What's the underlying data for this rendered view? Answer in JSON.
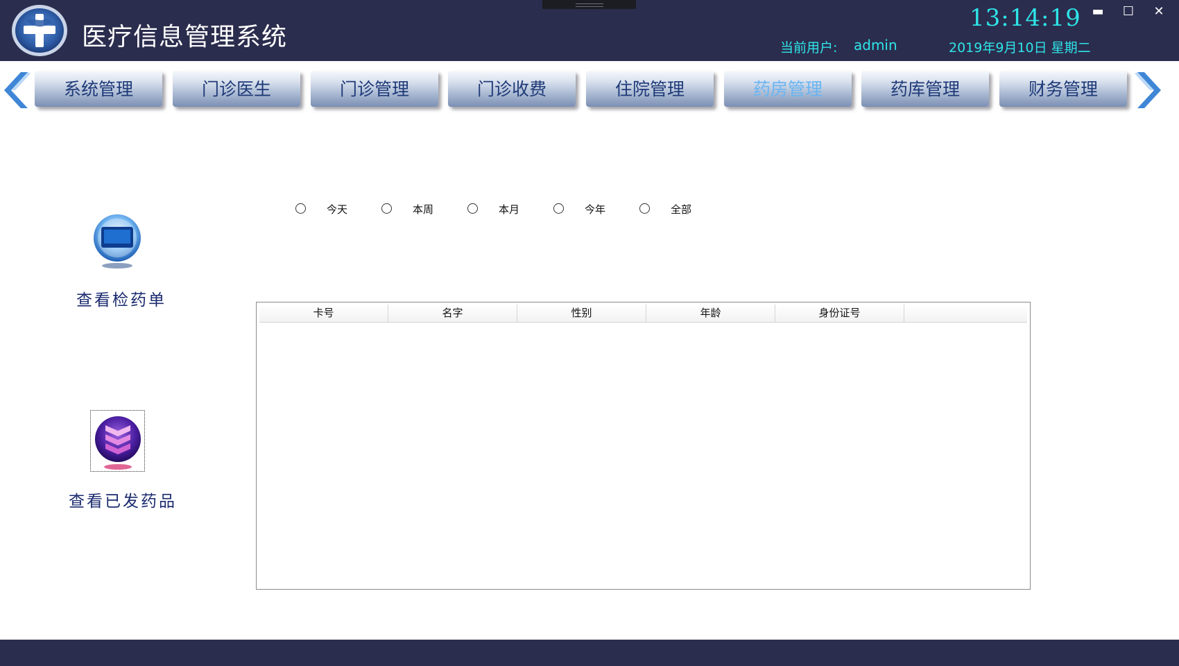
{
  "header": {
    "title": "医疗信息管理系统",
    "clock": "13:14:19",
    "user_label": "当前用户:",
    "user_name": "admin",
    "date": "2019年9月10日 星期二",
    "window_controls": {
      "minimize": "▬",
      "maximize": "☐",
      "close": "✕"
    }
  },
  "nav": {
    "items": [
      {
        "label": "系统管理"
      },
      {
        "label": "门诊医生"
      },
      {
        "label": "门诊管理"
      },
      {
        "label": "门诊收费"
      },
      {
        "label": "住院管理"
      },
      {
        "label": "药房管理",
        "active": true
      },
      {
        "label": "药库管理"
      },
      {
        "label": "财务管理"
      }
    ],
    "prev_icon": "chevron-left-icon",
    "next_icon": "chevron-right-icon"
  },
  "sidebar": {
    "items": [
      {
        "label": "查看检药单",
        "icon": "monitor-icon"
      },
      {
        "label": "查看已发药品",
        "icon": "layers-icon"
      }
    ]
  },
  "filter": {
    "options": [
      "今天",
      "本周",
      "本月",
      "今年",
      "全部"
    ],
    "selected": null
  },
  "table": {
    "columns": [
      "卡号",
      "名字",
      "性别",
      "年龄",
      "身份证号"
    ],
    "rows": []
  },
  "colors": {
    "header_bg": "#2b2d4e",
    "accent_cyan": "#2ee5e8",
    "nav_text": "#1f3a78",
    "nav_active_text": "#69b5f2",
    "arrow_blue": "#3f86d6"
  }
}
